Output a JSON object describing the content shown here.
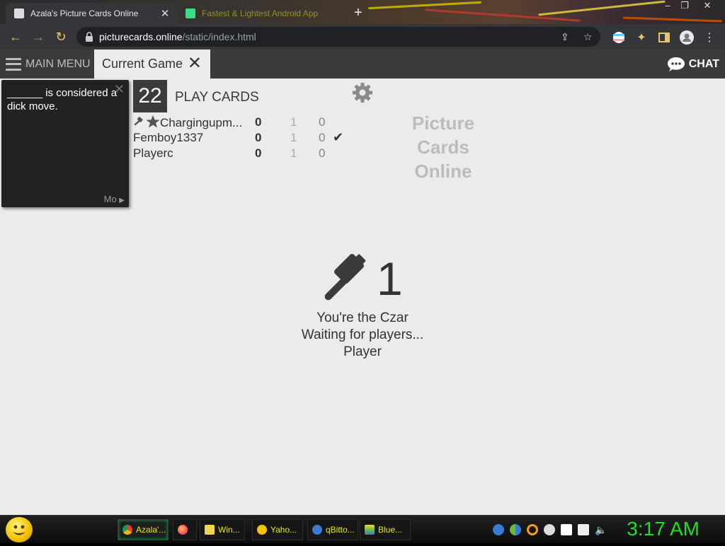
{
  "browser": {
    "active_tab_title": "Azala's Picture Cards Online",
    "inactive_tab_title": "Fastest & Lightest Android App",
    "url_host": "picturecards.online",
    "url_path": "/static/index.html"
  },
  "appbar": {
    "main_menu_label": "MAIN MENU",
    "current_tab_label": "Current Game",
    "chat_label": "CHAT"
  },
  "black_card": {
    "text": "______ is considered a dick move.",
    "more_label": "Mo"
  },
  "game": {
    "round": "22",
    "play_label": "PLAY CARDS",
    "logo_lines": [
      "Picture",
      "Cards",
      "Online"
    ]
  },
  "players": [
    {
      "name": "Chargingupm...",
      "score": "0",
      "col2": "1",
      "col3": "0",
      "played": false
    },
    {
      "name": "Femboy1337",
      "score": "0",
      "col2": "1",
      "col3": "0",
      "played": true
    },
    {
      "name": "Playerc",
      "score": "0",
      "col2": "1",
      "col3": "0",
      "played": false
    }
  ],
  "status": {
    "count": "1",
    "line1": "You're the Czar",
    "line2": "Waiting for players...",
    "line3": "Player"
  },
  "taskbar": {
    "buttons": [
      {
        "label": "Azala'...",
        "color": "#4caf50"
      },
      {
        "label": "",
        "color": "#ff7139"
      },
      {
        "label": "Win...",
        "color": "#f2d34d"
      },
      {
        "label": "Yaho...",
        "color": "#f5c400"
      },
      {
        "label": "qBitto...",
        "color": "#3a7bd5"
      },
      {
        "label": "Blue...",
        "color": "#6dbb3a"
      }
    ],
    "clock": "3:17 AM"
  },
  "colors": {
    "game_bg": "#ebebeb",
    "header_bg": "#3b3b3b",
    "card_bg": "#222222",
    "clock": "#22dd22",
    "taskbar_text": "#e8e800"
  }
}
